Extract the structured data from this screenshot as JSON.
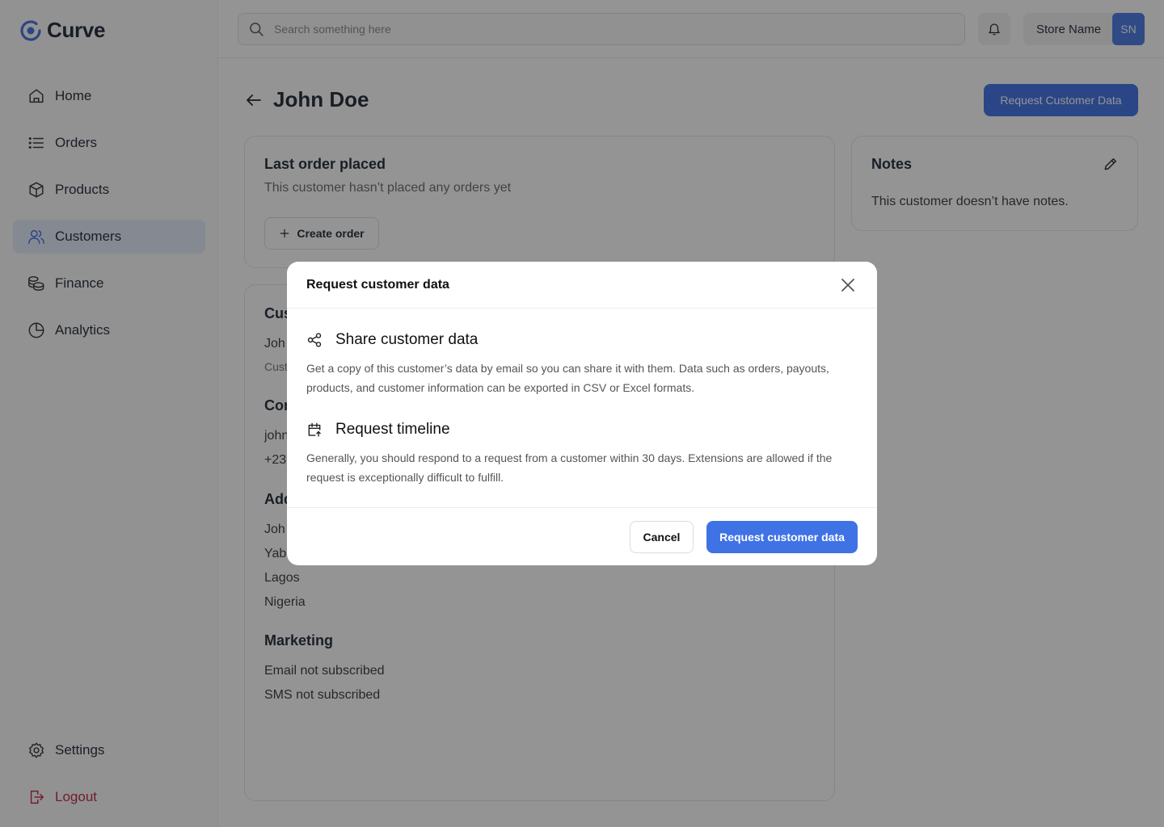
{
  "brand": {
    "name": "Curve",
    "accent": "#3f72e5"
  },
  "sidebar": {
    "items": [
      {
        "label": "Home",
        "icon": "home-icon"
      },
      {
        "label": "Orders",
        "icon": "list-icon"
      },
      {
        "label": "Products",
        "icon": "box-icon"
      },
      {
        "label": "Customers",
        "icon": "users-icon",
        "active": true
      },
      {
        "label": "Finance",
        "icon": "coins-icon"
      },
      {
        "label": "Analytics",
        "icon": "pie-chart-icon"
      }
    ],
    "bottom": [
      {
        "label": "Settings",
        "icon": "gear-icon"
      },
      {
        "label": "Logout",
        "icon": "logout-icon"
      }
    ]
  },
  "topbar": {
    "search_placeholder": "Search something here",
    "store_name": "Store Name",
    "avatar_initials": "SN"
  },
  "page": {
    "title": "John Doe",
    "request_button": "Request Customer Data"
  },
  "last_order": {
    "title": "Last order placed",
    "text": "This customer hasn’t placed any orders yet",
    "create_button": "Create order"
  },
  "notes": {
    "title": "Notes",
    "text": "This customer doesn’t have notes."
  },
  "customer": {
    "section_heading_partial": "Cus",
    "name_partial": "Joh",
    "sub_partial": "Cust",
    "contact_heading_partial": "Con",
    "email_partial": "john",
    "phone_partial": "+23",
    "address_heading_partial": "Add",
    "address_line1_partial": "Joh",
    "address_line2_partial": "Yab",
    "address_city": "Lagos",
    "address_country": "Nigeria",
    "marketing_heading": "Marketing",
    "email_status": "Email not subscribed",
    "sms_status": "SMS not subscribed"
  },
  "modal": {
    "title": "Request customer data",
    "sections": [
      {
        "title": "Share customer data",
        "icon": "share-icon",
        "body": "Get a copy of this customer’s data by email so you can share it with them. Data such as orders, payouts, products, and customer information can be exported in CSV or Excel formats."
      },
      {
        "title": "Request timeline",
        "icon": "calendar-icon",
        "body": "Generally, you should respond to a request from a customer within 30 days. Extensions are allowed if the request is exceptionally difficult to fulfill."
      }
    ],
    "cancel_label": "Cancel",
    "confirm_label": "Request customer data"
  }
}
